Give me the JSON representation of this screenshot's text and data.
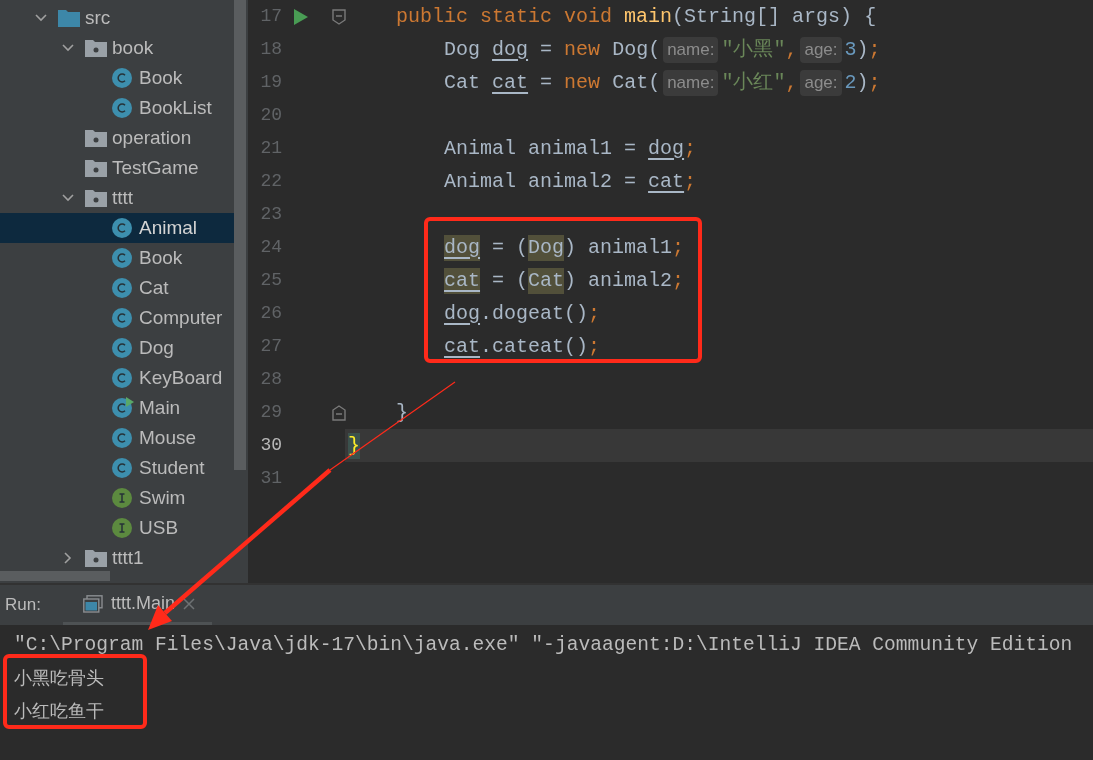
{
  "project_tree": [
    {
      "label": "src",
      "kind": "source-folder",
      "expanded": true,
      "selected": false,
      "children": [
        {
          "label": "book",
          "kind": "package",
          "expanded": true,
          "selected": false,
          "children": [
            {
              "label": "Book",
              "kind": "class",
              "selected": false
            },
            {
              "label": "BookList",
              "kind": "class",
              "selected": false
            }
          ]
        },
        {
          "label": "operation",
          "kind": "package",
          "selected": false
        },
        {
          "label": "TestGame",
          "kind": "package",
          "selected": false
        },
        {
          "label": "tttt",
          "kind": "package",
          "expanded": true,
          "selected": false,
          "children": [
            {
              "label": "Animal",
              "kind": "class",
              "selected": true
            },
            {
              "label": "Book",
              "kind": "class",
              "selected": false
            },
            {
              "label": "Cat",
              "kind": "class",
              "selected": false
            },
            {
              "label": "Computer",
              "kind": "class",
              "selected": false
            },
            {
              "label": "Dog",
              "kind": "class",
              "selected": false
            },
            {
              "label": "KeyBoard",
              "kind": "class",
              "selected": false
            },
            {
              "label": "Main",
              "kind": "runnable-class",
              "selected": false
            },
            {
              "label": "Mouse",
              "kind": "class",
              "selected": false
            },
            {
              "label": "Student",
              "kind": "class",
              "selected": false
            },
            {
              "label": "Swim",
              "kind": "interface",
              "selected": false
            },
            {
              "label": "USB",
              "kind": "interface",
              "selected": false
            }
          ]
        },
        {
          "label": "tttt1",
          "kind": "package",
          "expanded": false,
          "selected": false
        }
      ]
    }
  ],
  "editor": {
    "lines": [
      {
        "number": "17",
        "current": false,
        "run_marker": true,
        "fold_start": true,
        "tokens": [
          {
            "text": "    public static void",
            "kind": "kw"
          },
          {
            "text": " main",
            "kind": "method"
          },
          {
            "text": "(String[] args) {",
            "kind": "plain"
          }
        ]
      },
      {
        "number": "18",
        "current": false,
        "tokens": [
          {
            "text": "        Dog ",
            "kind": "plain"
          },
          {
            "text": "dog",
            "kind": "var"
          },
          {
            "text": " = ",
            "kind": "plain"
          },
          {
            "text": "new",
            "kind": "kw"
          },
          {
            "text": " Dog(",
            "kind": "plain"
          },
          {
            "text": "name:",
            "kind": "hint"
          },
          {
            "text": "\"小黑\"",
            "kind": "string"
          },
          {
            "text": ",",
            "kind": "punct"
          },
          {
            "text": "age:",
            "kind": "hint"
          },
          {
            "text": "3",
            "kind": "num"
          },
          {
            "text": ")",
            "kind": "plain"
          },
          {
            "text": ";",
            "kind": "punct"
          }
        ]
      },
      {
        "number": "19",
        "current": false,
        "tokens": [
          {
            "text": "        Cat ",
            "kind": "plain"
          },
          {
            "text": "cat",
            "kind": "var"
          },
          {
            "text": " = ",
            "kind": "plain"
          },
          {
            "text": "new",
            "kind": "kw"
          },
          {
            "text": " Cat(",
            "kind": "plain"
          },
          {
            "text": "name:",
            "kind": "hint"
          },
          {
            "text": "\"小红\"",
            "kind": "string"
          },
          {
            "text": ",",
            "kind": "punct"
          },
          {
            "text": "age:",
            "kind": "hint"
          },
          {
            "text": "2",
            "kind": "num"
          },
          {
            "text": ")",
            "kind": "plain"
          },
          {
            "text": ";",
            "kind": "punct"
          }
        ]
      },
      {
        "number": "20",
        "current": false
      },
      {
        "number": "21",
        "current": false,
        "tokens": [
          {
            "text": "        Animal animal1 = ",
            "kind": "plain"
          },
          {
            "text": "dog",
            "kind": "var"
          },
          {
            "text": ";",
            "kind": "punct"
          }
        ]
      },
      {
        "number": "22",
        "current": false,
        "tokens": [
          {
            "text": "        Animal animal2 = ",
            "kind": "plain"
          },
          {
            "text": "cat",
            "kind": "var"
          },
          {
            "text": ";",
            "kind": "punct"
          }
        ]
      },
      {
        "number": "23",
        "current": false
      },
      {
        "number": "24",
        "current": false,
        "tokens": [
          {
            "text": "        dog",
            "kind": "hl-var"
          },
          {
            "text": " = (",
            "kind": "plain"
          },
          {
            "text": "Dog",
            "kind": "hl-type"
          },
          {
            "text": ") animal1",
            "kind": "plain"
          },
          {
            "text": ";",
            "kind": "punct"
          }
        ]
      },
      {
        "number": "25",
        "current": false,
        "tokens": [
          {
            "text": "        cat",
            "kind": "hl-var"
          },
          {
            "text": " = (",
            "kind": "plain"
          },
          {
            "text": "Cat",
            "kind": "hl-type"
          },
          {
            "text": ") animal2",
            "kind": "plain"
          },
          {
            "text": ";",
            "kind": "punct"
          }
        ]
      },
      {
        "number": "26",
        "current": false,
        "tokens": [
          {
            "text": "        dog",
            "kind": "var"
          },
          {
            "text": ".dogeat()",
            "kind": "plain"
          },
          {
            "text": ";",
            "kind": "punct"
          }
        ]
      },
      {
        "number": "27",
        "current": false,
        "tokens": [
          {
            "text": "        cat",
            "kind": "var"
          },
          {
            "text": ".cateat()",
            "kind": "plain"
          },
          {
            "text": ";",
            "kind": "punct"
          }
        ]
      },
      {
        "number": "28",
        "current": false
      },
      {
        "number": "29",
        "current": false,
        "fold_end": true,
        "tokens": [
          {
            "text": "    }",
            "kind": "plain"
          }
        ]
      },
      {
        "number": "30",
        "current": true,
        "tokens": [
          {
            "text": "}",
            "kind": "brace-match"
          }
        ]
      },
      {
        "number": "31",
        "current": false
      }
    ]
  },
  "run_panel": {
    "label": "Run:",
    "tabs": [
      {
        "label": "tttt.Main",
        "selected": true
      }
    ]
  },
  "console": {
    "lines": [
      {
        "text": "\"C:\\Program Files\\Java\\jdk-17\\bin\\java.exe\" \"-javaagent:D:\\IntelliJ IDEA Community Edition",
        "kind": "command"
      },
      {
        "text": "小黑吃骨头",
        "kind": "output"
      },
      {
        "text": "小红吃鱼干",
        "kind": "output"
      }
    ]
  }
}
